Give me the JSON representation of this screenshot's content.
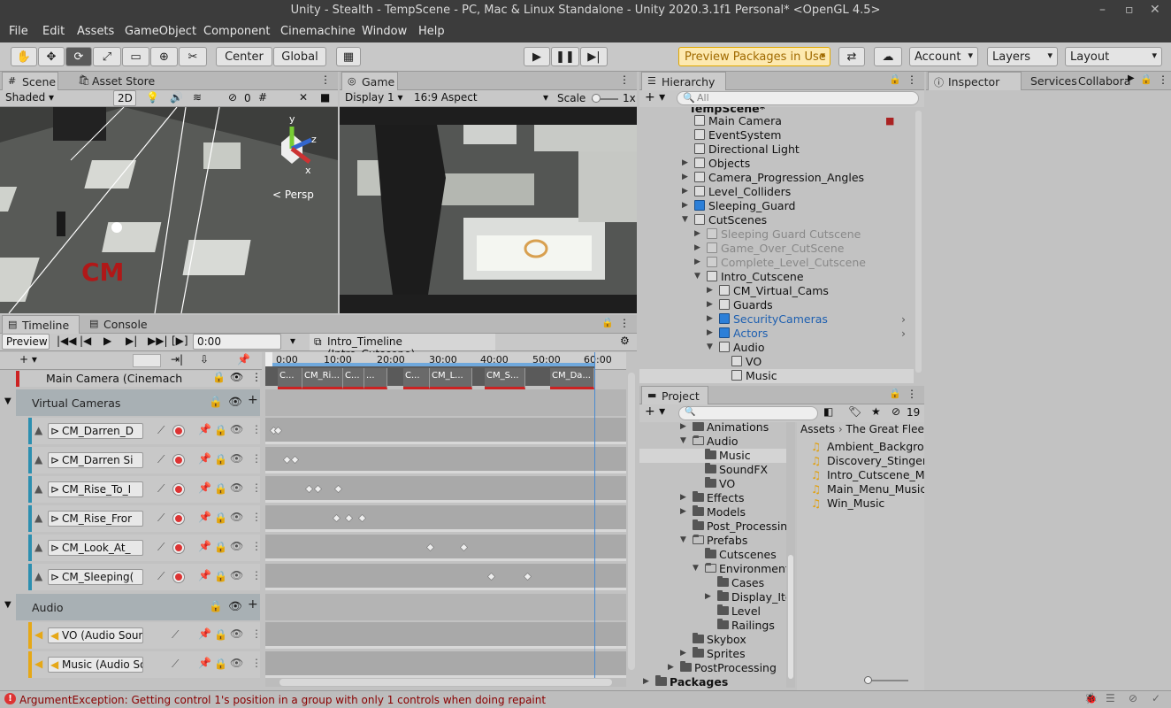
{
  "window": {
    "title": "Unity - Stealth - TempScene - PC, Mac & Linux Standalone - Unity 2020.3.1f1 Personal* <OpenGL 4.5>"
  },
  "menu": [
    "File",
    "Edit",
    "Assets",
    "GameObject",
    "Component",
    "Cinemachine",
    "Window",
    "Help"
  ],
  "toolbar": {
    "center": "Center",
    "global": "Global",
    "preview_packages": "Preview Packages in Use",
    "account": "Account",
    "layers": "Layers",
    "layout": "Layout"
  },
  "scene": {
    "tab": "Scene",
    "asset_store": "Asset Store",
    "shading": "Shaded",
    "mode2d": "2D",
    "hidden_count": "0",
    "persp": "< Persp"
  },
  "game": {
    "tab": "Game",
    "display": "Display 1",
    "aspect": "16:9 Aspect",
    "scale_label": "Scale",
    "scale_value": "1x"
  },
  "hierarchy": {
    "tab": "Hierarchy",
    "search_placeholder": "All",
    "scene_name": "TempScene*",
    "items": [
      "Main Camera",
      "EventSystem",
      "Directional Light",
      "Objects",
      "Camera_Progression_Angles",
      "Level_Colliders",
      "Sleeping_Guard",
      "CutScenes",
      "Sleeping Guard Cutscene",
      "Game_Over_CutScene",
      "Complete_Level_Cutscene",
      "Intro_Cutscene",
      "CM_Virtual_Cams",
      "Guards",
      "SecurityCameras",
      "Actors",
      "Audio",
      "VO",
      "Music"
    ]
  },
  "inspector": {
    "tab": "Inspector",
    "services": "Services",
    "collab": "Collabora"
  },
  "timeline": {
    "tab": "Timeline",
    "console": "Console",
    "preview": "Preview",
    "time": "0:00",
    "asset": "Intro_Timeline (Intro_Cutscene)",
    "ruler": [
      "0:00",
      "10:00",
      "20:00",
      "30:00",
      "40:00",
      "50:00",
      "60:00"
    ],
    "main_camera": "Main Camera (Cinemach",
    "clips": [
      "C...",
      "CM_Ri...",
      "C...",
      "...",
      "C...",
      "CM_L...",
      "CM_S...",
      "CM_Da..."
    ],
    "group_virtual": "Virtual Cameras",
    "tracks": [
      "CM_Darren_D",
      "CM_Darren Si",
      "CM_Rise_To_I",
      "CM_Rise_Fror",
      "CM_Look_At_",
      "CM_Sleeping("
    ],
    "group_audio": "Audio",
    "audio_tracks": [
      "VO (Audio Source",
      "Music (Audio Sou"
    ]
  },
  "project": {
    "tab": "Project",
    "hidden": "19",
    "tree": [
      "Animations",
      "Audio",
      "Music",
      "SoundFX",
      "VO",
      "Effects",
      "Models",
      "Post_Processing",
      "Prefabs",
      "Cutscenes",
      "Environment",
      "Cases",
      "Display_Items",
      "Level",
      "Railings",
      "Skybox",
      "Sprites",
      "PostProcessing",
      "Packages"
    ],
    "breadcrumb_root": "Assets",
    "breadcrumb_folder": "The Great Fleec",
    "files": [
      "Ambient_Background",
      "Discovery_Stinger_M",
      "Intro_Cutscene_Music",
      "Main_Menu_Music",
      "Win_Music"
    ]
  },
  "status": {
    "error": "ArgumentException: Getting control 1's position in a group with only 1 controls when doing repaint"
  },
  "colors": {
    "accent_blue": "#2c7fd8",
    "error_red": "#c22",
    "preview_orange": "#f0a500"
  }
}
